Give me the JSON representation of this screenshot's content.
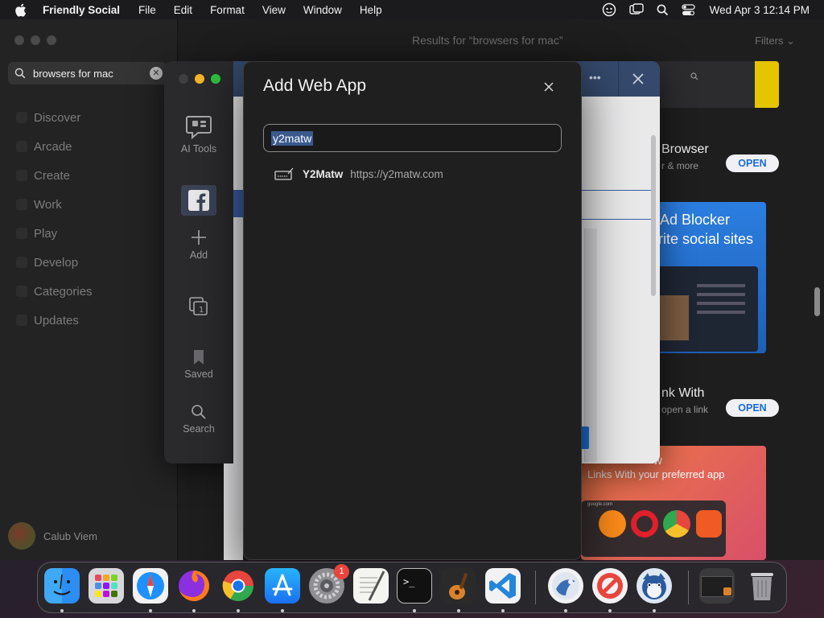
{
  "menubar": {
    "app_name": "Friendly Social",
    "menus": [
      "File",
      "Edit",
      "Format",
      "View",
      "Window",
      "Help"
    ],
    "clock": "Wed Apr 3  12:14 PM"
  },
  "appstore": {
    "search_value": "browsers for mac",
    "nav": [
      "Discover",
      "Arcade",
      "Create",
      "Work",
      "Play",
      "Develop",
      "Categories",
      "Updates"
    ],
    "user_name": "Calub Viem",
    "results_title": "Results for “browsers for mac”",
    "filters_label": "Filters",
    "cards": [
      {
        "title": "Browser",
        "subtitle": "r & more",
        "button": "OPEN"
      },
      {
        "banner_line1": "Ad Blocker",
        "banner_line2": "rite social sites"
      },
      {
        "title": "nk With",
        "subtitle": "open a link",
        "button": "OPEN"
      },
      {
        "banner_line1": "w",
        "banner_line2": "Links With your preferred app",
        "banner_url": "google.com"
      }
    ]
  },
  "friendly_social": {
    "tools": [
      {
        "label": "AI Tools",
        "icon": "chat-icon"
      },
      {
        "label": "",
        "icon": "facebook-icon"
      },
      {
        "label": "Add",
        "icon": "plus-icon"
      },
      {
        "label": "",
        "icon": "copy-icon"
      },
      {
        "label": "Saved",
        "icon": "bookmark-icon"
      },
      {
        "label": "Search",
        "icon": "search-icon"
      }
    ]
  },
  "dialog": {
    "title": "Add Web App",
    "input_value": "y2matw",
    "results": [
      {
        "name": "Y2Matw",
        "url": "https://y2matw.com",
        "icon": "keyboard-icon"
      }
    ]
  },
  "dock": {
    "settings_badge": "1",
    "colors": {
      "finder": "#2c8df2",
      "safari": "#1e90ff",
      "chrome": "#e8453c",
      "appstore": "#1b8cf3",
      "vscode": "#2486d8"
    }
  }
}
